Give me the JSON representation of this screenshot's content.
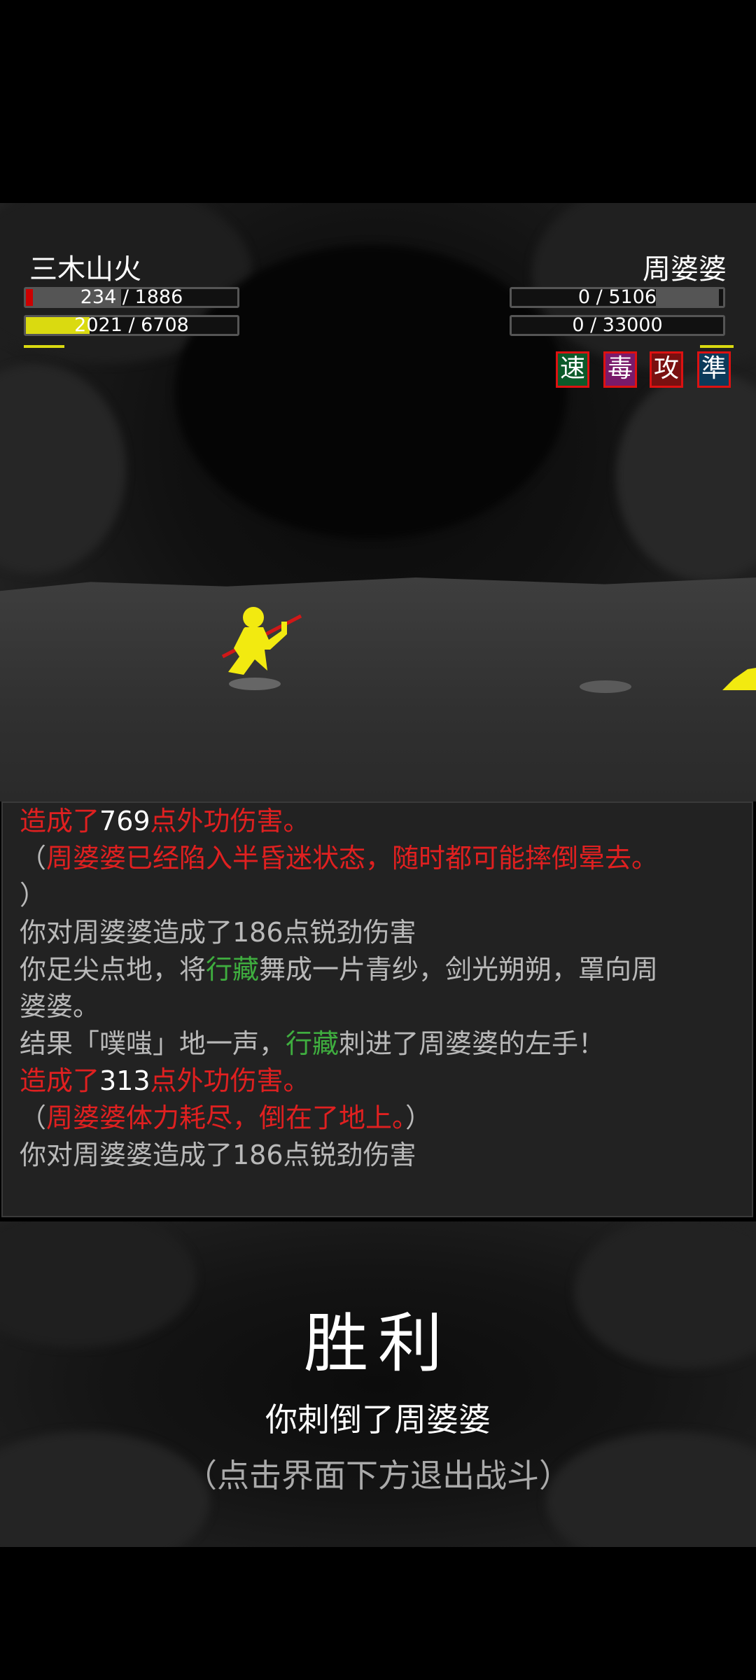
{
  "player": {
    "name": "三木山火",
    "hp_text": "234 / 1886",
    "hp_fraction": 0.124,
    "mp_text": "2021 / 6708",
    "mp_fraction": 0.3,
    "hp_color": "#cc0000",
    "mp_color": "#dada10"
  },
  "enemy": {
    "name": "周婆婆",
    "hp_text": "0 / 5106",
    "mp_text": "0 / 33000",
    "statuses": [
      {
        "label": "速",
        "bg": "#0c5a2a"
      },
      {
        "label": "毒",
        "bg": "#7a1a6a"
      },
      {
        "label": "攻",
        "bg": "#7a1010"
      },
      {
        "label": "準",
        "bg": "#0c3a5a"
      }
    ]
  },
  "log": {
    "lines": [
      {
        "parts": [
          {
            "t": "造成了",
            "c": "red"
          },
          {
            "t": "769",
            "c": "white"
          },
          {
            "t": "点外功伤害。",
            "c": "red"
          }
        ]
      },
      {
        "parts": [
          {
            "t": "（",
            "c": ""
          },
          {
            "t": "周婆婆已经陷入半昏迷状态，随时都可能摔倒晕去。",
            "c": "red"
          }
        ]
      },
      {
        "parts": [
          {
            "t": "）",
            "c": ""
          }
        ]
      },
      {
        "parts": [
          {
            "t": "你对周婆婆造成了186点锐劲伤害",
            "c": ""
          }
        ]
      },
      {
        "parts": [
          {
            "t": "你足尖点地，将",
            "c": ""
          },
          {
            "t": "行藏",
            "c": "green"
          },
          {
            "t": "舞成一片青纱，剑光朔朔，罩向周",
            "c": ""
          }
        ]
      },
      {
        "parts": [
          {
            "t": "婆婆。",
            "c": ""
          }
        ]
      },
      {
        "parts": [
          {
            "t": "结果「噗嗤」地一声，",
            "c": ""
          },
          {
            "t": "行藏",
            "c": "green"
          },
          {
            "t": "刺进了周婆婆的左手！",
            "c": ""
          }
        ]
      },
      {
        "parts": [
          {
            "t": "造成了",
            "c": "red"
          },
          {
            "t": "313",
            "c": "white"
          },
          {
            "t": "点外功伤害。",
            "c": "red"
          }
        ]
      },
      {
        "parts": [
          {
            "t": "（",
            "c": ""
          },
          {
            "t": "周婆婆体力耗尽，倒在了地上。",
            "c": "red"
          },
          {
            "t": "）",
            "c": ""
          }
        ]
      },
      {
        "parts": [
          {
            "t": "你对周婆婆造成了186点锐劲伤害",
            "c": ""
          }
        ]
      }
    ]
  },
  "result": {
    "title": "胜利",
    "message": "你刺倒了周婆婆",
    "hint": "（点击界面下方退出战斗）"
  }
}
